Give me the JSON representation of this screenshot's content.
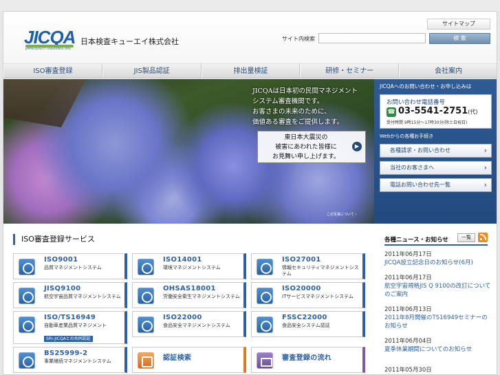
{
  "header": {
    "logo_text": "JICQA",
    "logo_subtext": "JAPAN QUALITY ASSURANCE ORG",
    "company_name": "日本検査キューエイ株式会社",
    "sitemap_label": "サイトマップ",
    "search_label": "サイト内検索",
    "search_placeholder": "",
    "search_button": "検 索"
  },
  "nav": {
    "items": [
      {
        "label": "ISO審査登録"
      },
      {
        "label": "JIS製品認証"
      },
      {
        "label": "排出量検証"
      },
      {
        "label": "研修・セミナー"
      },
      {
        "label": "会社案内"
      }
    ]
  },
  "hero": {
    "copy_lines": [
      "JICQAは日本初の民間マネジメント",
      "システム審査機関です。",
      "お客さまの未来のために、",
      "価値ある審査をご提供します。"
    ],
    "notice_lines": [
      "東日本大震災の",
      "被害にあわれた皆様に",
      "お見舞い申し上げます。"
    ],
    "caption": "この写真について ›"
  },
  "contact": {
    "heading": "JICQAへのお問い合わせ・お申し込みは",
    "phone_label": "お問い合わせ電話番号",
    "phone_number": "03-5541-2751",
    "phone_suffix": "(代)",
    "hours": "受付時間 9時15分〜17時30分(除土日祝日)",
    "web_label": "Webからの各種お手続き",
    "buttons": [
      {
        "label": "各種請求・お問い合わせ"
      },
      {
        "label": "当社のお客さまへ"
      },
      {
        "label": "電話お問い合わせ先一覧"
      }
    ]
  },
  "services": {
    "title": "ISO審査登録サービス",
    "cards": [
      {
        "title": "ISO9001",
        "sub": "品質マネジメントシステム",
        "badge": ""
      },
      {
        "title": "ISO14001",
        "sub": "環境マネジメントシステム",
        "badge": ""
      },
      {
        "title": "ISO27001",
        "sub": "情報セキュリティマネジメントシステム",
        "badge": ""
      },
      {
        "title": "JISQ9100",
        "sub": "航空宇宙品質マネジメントシステム",
        "badge": ""
      },
      {
        "title": "OHSAS18001",
        "sub": "労働安全衛生マネジメントシステム",
        "badge": ""
      },
      {
        "title": "ISO20000",
        "sub": "ITサービスマネジメントシステム",
        "badge": ""
      },
      {
        "title": "ISO/TS16949",
        "sub": "自動車産業品質マネジメント",
        "badge": "SRI-JICQAとの共同認証"
      },
      {
        "title": "ISO22000",
        "sub": "食品安全マネジメントシステム",
        "badge": ""
      },
      {
        "title": "FSSC22000",
        "sub": "食品安全システム認証",
        "badge": ""
      },
      {
        "title": "BS25999-2",
        "sub": "事業継続マネジメントシステム",
        "badge": ""
      },
      {
        "title": "認証検索",
        "sub": "",
        "badge": ""
      },
      {
        "title": "審査登録の流れ",
        "sub": "",
        "badge": ""
      }
    ]
  },
  "news": {
    "title": "各種ニュース・お知らせ",
    "list_button": "一覧",
    "items": [
      {
        "date": "2011年06月17日",
        "text": "JICQA設立記念日のお知らせ(6月)"
      },
      {
        "date": "2011年06月17日",
        "text": "航空宇宙規格JIS Q 9100の改訂についてのご案内"
      },
      {
        "date": "2011年06月13日",
        "text": "2011年8月開催のTS16949セミナーのお知らせ"
      },
      {
        "date": "2011年06月04日",
        "text": "夏季休業期間についてのお知らせ"
      },
      {
        "date": "2011年05月30日",
        "text": ""
      }
    ]
  },
  "colors": {
    "brand_blue": "#2c62a3",
    "accent_orange": "#e07a20",
    "accent_purple": "#7a5aa5",
    "contact_panel": "#2f5b95"
  }
}
